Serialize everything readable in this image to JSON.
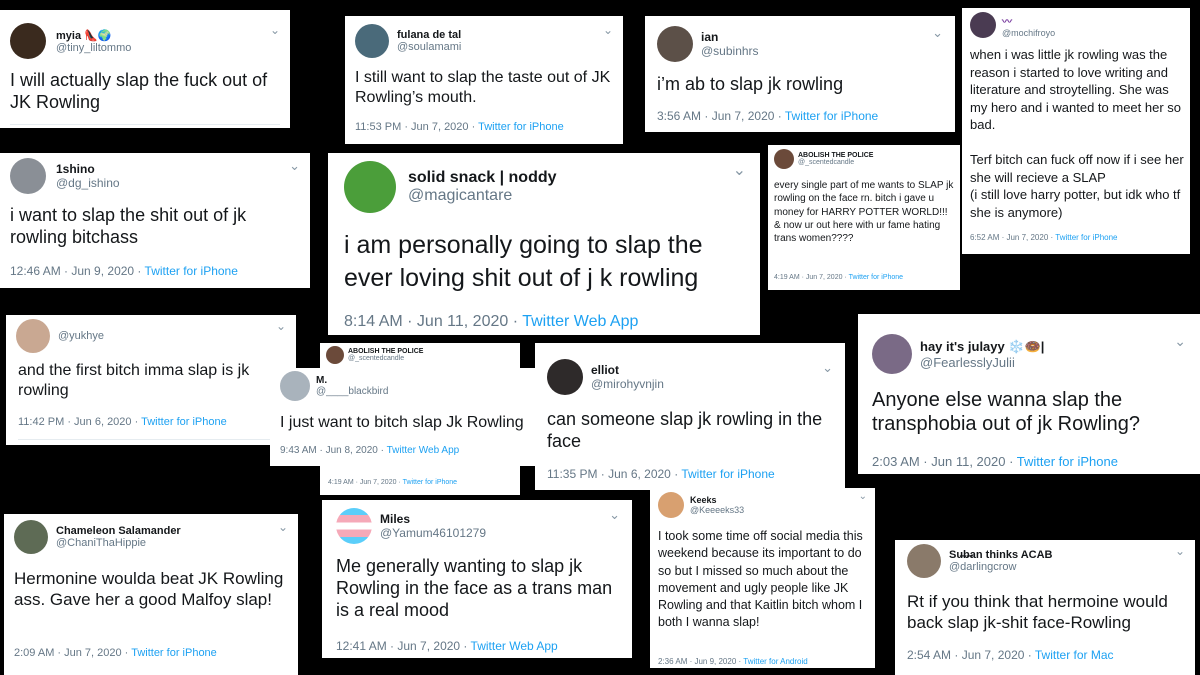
{
  "tweets": [
    {
      "id": "t1",
      "name": "myia 👠🌍",
      "handle": "@tiny_liltommo",
      "text": "I will actually slap the fuck out of JK Rowling",
      "time": "",
      "source": "",
      "avatar_color": "#3a2a1e"
    },
    {
      "id": "t2",
      "name": "fulana de tal",
      "handle": "@soulamami",
      "text": "I still want to slap the taste out of JK Rowling’s mouth.",
      "time": "11:53 PM · Jun 7, 2020 · ",
      "source": "Twitter for iPhone",
      "avatar_color": "#4a6a7a"
    },
    {
      "id": "t3",
      "name": "ian",
      "handle": "@subinhrs",
      "text": "i’m ab to slap jk rowling",
      "time": "3:56 AM · Jun 7, 2020 · ",
      "source": "Twitter for iPhone",
      "avatar_color": "#5c5048"
    },
    {
      "id": "t4",
      "name": "〰",
      "handle": "@mochifroyo",
      "text": "when i was little jk rowling was the reason i started to love writing and literature and stroytelling. She was my hero and i wanted to meet her so bad.\n\nTerf bitch can fuck off now if i see her she will recieve a SLAP\n(i still love harry potter, but idk who tf she is anymore)",
      "time": "6:52 AM · Jun 7, 2020 · ",
      "source": "Twitter for iPhone",
      "avatar_color": "#4a3b52"
    },
    {
      "id": "t5",
      "name": "1shino",
      "handle": "@dg_ishino",
      "text": "i want to slap the shit out of jk rowling bitchass",
      "time": "12:46 AM · Jun 9, 2020 · ",
      "source": "Twitter for iPhone",
      "avatar_color": "#8a8f96"
    },
    {
      "id": "t6",
      "name": "solid snack | noddy",
      "handle": "@magicantare",
      "text": "i am personally going to slap the ever loving shit out of j k rowling",
      "time": "8:14 AM · Jun 11, 2020 · ",
      "source": "Twitter Web App",
      "avatar_color": "#4b9e3a"
    },
    {
      "id": "t7",
      "name": "ABOLISH THE POLICE",
      "handle": "@_scentedcandle",
      "text": "every single part of me wants to SLAP jk rowling on the face rn. bitch i gave u money for HARRY POTTER WORLD!!! & now ur out here with ur fame hating trans women????",
      "time": "4:19 AM · Jun 7, 2020 · ",
      "source": "Twitter for iPhone",
      "avatar_color": "#6b4a3a"
    },
    {
      "id": "t8",
      "name": "",
      "handle": "@yukhye",
      "text": "and the first bitch imma slap is jk rowling",
      "time": "11:42 PM · Jun 6, 2020 · ",
      "source": "Twitter for iPhone",
      "avatar_color": "#c9a892"
    },
    {
      "id": "t9a",
      "name": "ABOLISH THE POLICE",
      "handle": "@_scentedcandle",
      "time": "4:19 AM · Jun 7, 2020 · ",
      "source": "Twitter for iPhone",
      "avatar_color": "#6b4a3a"
    },
    {
      "id": "t9",
      "name": "M.",
      "handle": "@____blackbird",
      "text": "I just want to bitch slap Jk Rowling",
      "time": "9:43 AM · Jun 8, 2020 · ",
      "source": "Twitter Web App",
      "avatar_color": "#a9b3bc"
    },
    {
      "id": "t10",
      "name": "elliot",
      "handle": "@mirohyvnjin",
      "text": "can someone slap jk rowling in the face",
      "time": "11:35 PM · Jun 6, 2020 · ",
      "source": "Twitter for iPhone",
      "avatar_color": "#2e2a2a"
    },
    {
      "id": "t11",
      "name": "hay it's julayy ❄️🍩|",
      "handle": "@FearlesslyJulii",
      "text": "Anyone else wanna slap the transphobia out of jk Rowling?",
      "time": "2:03 AM · Jun 11, 2020 · ",
      "source": "Twitter for iPhone",
      "avatar_color": "#7a6a86"
    },
    {
      "id": "t12",
      "name": "Chameleon Salamander",
      "handle": "@ChaniThaHippie",
      "text": "Hermonine woulda beat JK Rowling ass. Gave her a good Malfoy slap!",
      "time": "2:09 AM · Jun 7, 2020 · ",
      "source": "Twitter for iPhone",
      "avatar_color": "#5e6b55"
    },
    {
      "id": "t13",
      "name": "Miles",
      "handle": "@Yamum46101279",
      "text": "Me generally wanting to slap jk Rowling in the face as a trans man is a real mood",
      "time": "12:41 AM · Jun 7, 2020 · ",
      "source": "Twitter Web App",
      "avatar_color": "#5bcefa"
    },
    {
      "id": "t14",
      "name": "Keeks",
      "handle": "@Keeeeks33",
      "text": "I took some time off social media this weekend because its important to do so but I missed so much about the movement and ugly people like JK Rowling and that Kaitlin bitch whom I both I wanna slap!",
      "time": "2:36 AM · Jun 9, 2020 · ",
      "source": "Twitter for Android",
      "avatar_color": "#d8a070"
    },
    {
      "id": "t15",
      "name": "Su̶b̶an thinks ACAB",
      "handle": "@darlingcrow",
      "text": "Rt if you think that hermoine would back slap jk-shit face-Rowling",
      "time": "2:54 AM · Jun 7, 2020 · ",
      "source": "Twitter for Mac",
      "avatar_color": "#8a7a6a"
    }
  ],
  "icons": {
    "chevron": "chevron-down-icon"
  }
}
